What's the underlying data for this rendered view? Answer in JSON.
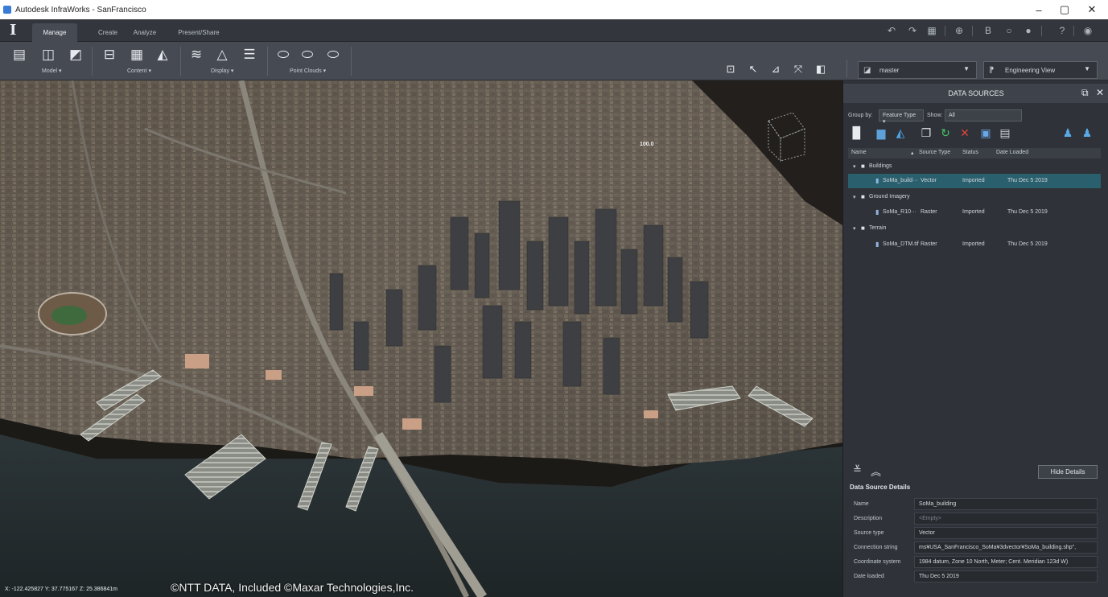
{
  "window": {
    "title": "Autodesk InfraWorks - SanFrancisco",
    "controls": {
      "minimize": "–",
      "maximize": "▢",
      "close": "✕"
    }
  },
  "menu": {
    "logo": "I",
    "tabs": [
      "Manage",
      "Create",
      "Analyze",
      "Present/Share"
    ],
    "active_tab": "Manage"
  },
  "ribbon": {
    "groups": [
      "Model ▾",
      "Content ▾",
      "Display ▾",
      "Point Clouds ▾"
    ],
    "proposal_value": "master",
    "view_value": "Engineering View"
  },
  "viewport": {
    "coordinates": "X: -122.425827 Y: 37.775167 Z: 25.386841m",
    "copyright": "©NTT DATA, Included ©Maxar Technologies,Inc.",
    "elevation_label": "100.0"
  },
  "data_sources": {
    "title": "DATA SOURCES",
    "group_by_label": "Group by:",
    "group_by_value": "Feature Type ▾",
    "show_label": "Show:",
    "show_value": "All",
    "columns": [
      "Name",
      "Source Type",
      "Status",
      "Date Loaded"
    ],
    "groups": [
      {
        "name": "Buildings",
        "items": [
          {
            "name": "SoMa_build···",
            "type": "Vector",
            "status": "Imported",
            "date": "Thu Dec 5 2019"
          }
        ]
      },
      {
        "name": "Ground Imagery",
        "items": [
          {
            "name": "SoMa_R10···",
            "type": "Raster",
            "status": "Imported",
            "date": "Thu Dec 5 2019"
          }
        ]
      },
      {
        "name": "Terrain",
        "items": [
          {
            "name": "SoMa_DTM.tif",
            "type": "Raster",
            "status": "Imported",
            "date": "Thu Dec 5 2019"
          }
        ]
      }
    ],
    "hide_details_label": "Hide Details",
    "details_title": "Data Source Details",
    "details": [
      {
        "key": "Name",
        "value": "SoMa_building"
      },
      {
        "key": "Description",
        "value": "<Empty>"
      },
      {
        "key": "Source type",
        "value": "Vector"
      },
      {
        "key": "Connection string",
        "value": "ms¥USA_SanFrancisco_SoMa¥3dvector¥SoMa_building.shp\","
      },
      {
        "key": "Coordinate system",
        "value": "1984 datum, Zone 10 North, Meter; Cent. Meridian 123d W)"
      },
      {
        "key": "Date loaded",
        "value": "Thu Dec 5 2019"
      }
    ]
  },
  "colors": {
    "accent_selection": "#2a5f6d",
    "panel_bg": "#2f3238",
    "ribbon_bg": "#464a52",
    "water": "#273033"
  }
}
